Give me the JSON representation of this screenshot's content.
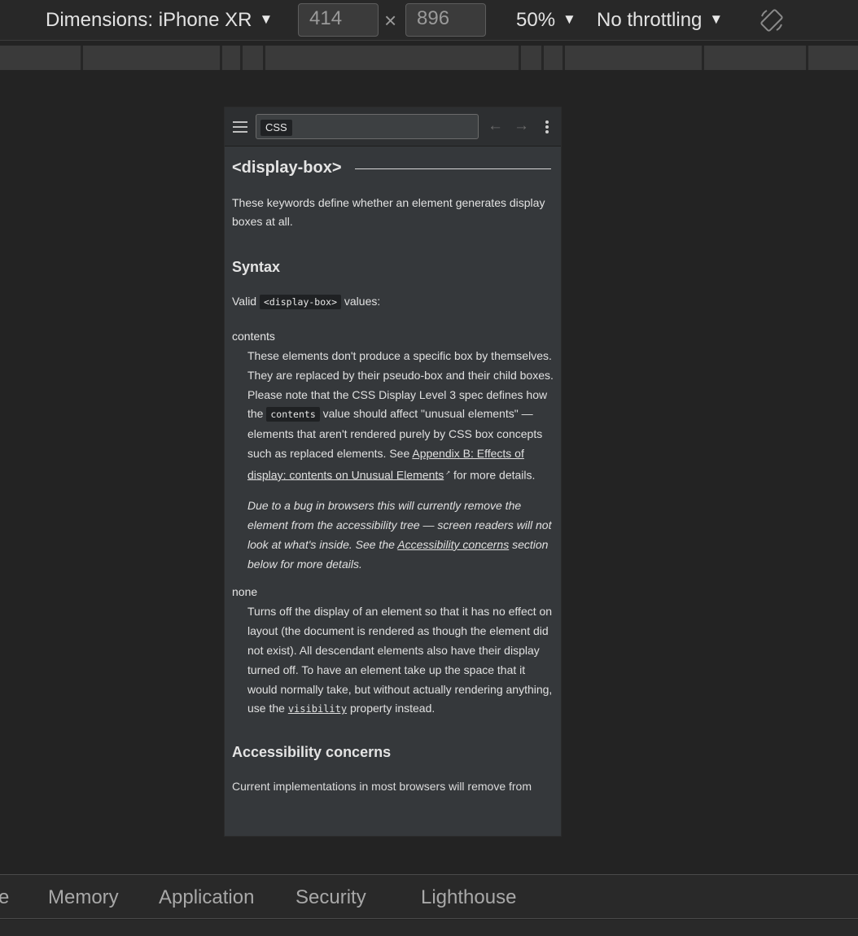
{
  "toolbar": {
    "device_label": "Dimensions: iPhone XR",
    "width": "414",
    "height": "896",
    "times": "×",
    "zoom": "50%",
    "throttling": "No throttling",
    "caret": "▼"
  },
  "device_header": {
    "search_chip": "CSS",
    "back_arrow": "←",
    "forward_arrow": "→"
  },
  "article": {
    "title": "<display-box>",
    "intro": "These keywords define whether an element generates display boxes at all.",
    "syntax_heading": "Syntax",
    "valid_prefix": "Valid",
    "valid_code": "<display-box>",
    "valid_suffix": "values:",
    "contents_term": "contents",
    "contents_desc_1": "These elements don't produce a specific box by themselves. They are replaced by their pseudo-box and their child boxes. Please note that the CSS Display Level 3 spec defines how the",
    "contents_code": "contents",
    "contents_desc_2": "value should affect \"unusual elements\" — elements that aren't rendered purely by CSS box concepts such as replaced elements. See",
    "contents_link": "Appendix B: Effects of display: contents on Unusual Elements",
    "contents_desc_3": "for more details.",
    "note_1": "Due to a bug in browsers this will currently remove the element from the accessibility tree — screen readers will not look at what's inside. See the",
    "note_link": "Accessibility concerns",
    "note_2": "section below for more details.",
    "none_term": "none",
    "none_desc_1": "Turns off the display of an element so that it has no effect on layout (the document is rendered as though the element did not exist). All descendant elements also have their display turned off. To have an element take up the space that it would normally take, but without actually rendering anything, use the",
    "none_link": "visibility",
    "none_desc_2": "property instead.",
    "a11y_heading": "Accessibility concerns",
    "cut_text": "Current implementations in most browsers will remove from"
  },
  "devtools_tabs": [
    "e",
    "Memory",
    "Application",
    "Security",
    "Lighthouse"
  ],
  "icons": [
    "caret-down-icon",
    "rotate-icon",
    "hamburger-icon",
    "back-arrow-icon",
    "forward-arrow-icon",
    "kebab-menu-icon",
    "external-link-icon"
  ]
}
